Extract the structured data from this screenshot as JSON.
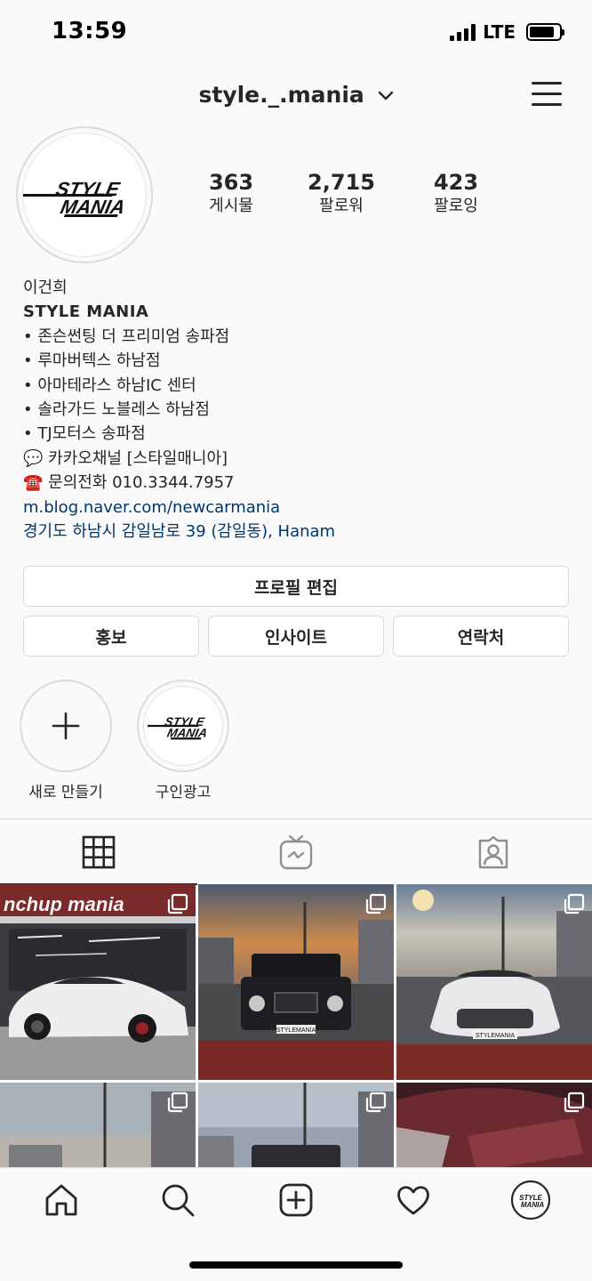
{
  "status_bar": {
    "time": "13:59",
    "network": "LTE"
  },
  "header": {
    "username": "style._.mania"
  },
  "profile": {
    "avatar_logo_text": "STYLE MANIA",
    "stats": [
      {
        "value": "363",
        "label": "게시물"
      },
      {
        "value": "2,715",
        "label": "팔로워"
      },
      {
        "value": "423",
        "label": "팔로잉"
      }
    ],
    "bio": {
      "name": "이건희",
      "brand": "STYLE MANIA",
      "lines": [
        "• 존슨썬팅 더 프리미엄 송파점",
        "• 루마버텍스 하남점",
        "• 아마테라스 하남IC 센터",
        "• 솔라가드 노블레스 하남점",
        "• TJ모터스 송파점",
        "💬 카카오채널 [스타일매니아]",
        "☎️ 문의전화 010.3344.7957"
      ],
      "link": "m.blog.naver.com/newcarmania",
      "location": "경기도 하남시 감일남로 39 (감일동), Hanam"
    }
  },
  "buttons": {
    "edit_profile": "프로필 편집",
    "promote": "홍보",
    "insights": "인사이트",
    "contact": "연락처"
  },
  "highlights": [
    {
      "label": "새로 만들기",
      "icon": "plus-icon"
    },
    {
      "label": "구인광고",
      "icon": "style-mania-logo"
    }
  ],
  "tabs": [
    {
      "name": "grid",
      "icon": "grid-icon",
      "active": true
    },
    {
      "name": "igtv",
      "icon": "igtv-icon",
      "active": false
    },
    {
      "name": "tagged",
      "icon": "tagged-user-icon",
      "active": false
    }
  ],
  "posts": [
    {
      "subject": "white Tesla in tint shop",
      "sign_text": "nchup mania"
    },
    {
      "subject": "black Mercedes G-class",
      "plate": "STYLEMANIA"
    },
    {
      "subject": "white Hyundai Sonata",
      "plate": "STYLEMANIA"
    },
    {
      "subject": "street at sunset"
    },
    {
      "subject": "convertible on street"
    },
    {
      "subject": "burgundy car hood"
    }
  ],
  "bottom_nav": [
    {
      "name": "home",
      "icon": "home-icon"
    },
    {
      "name": "search",
      "icon": "search-icon"
    },
    {
      "name": "new-post",
      "icon": "add-post-icon"
    },
    {
      "name": "activity",
      "icon": "heart-icon"
    },
    {
      "name": "profile",
      "icon": "profile-avatar-icon"
    }
  ],
  "colors": {
    "link": "#00376b",
    "border": "#dbdbdb",
    "text": "#262626",
    "background": "#fafafa"
  }
}
